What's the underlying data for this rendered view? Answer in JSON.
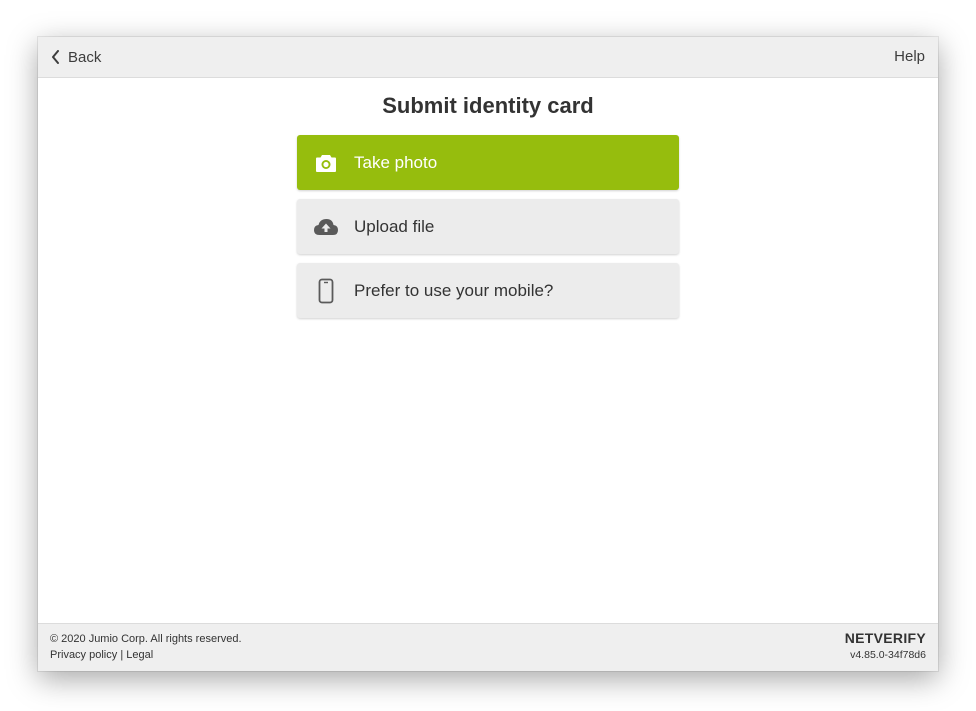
{
  "header": {
    "back_label": "Back",
    "help_label": "Help"
  },
  "main": {
    "title": "Submit identity card",
    "options": [
      {
        "label": "Take photo",
        "icon": "camera-icon"
      },
      {
        "label": "Upload file",
        "icon": "cloud-upload-icon"
      },
      {
        "label": "Prefer to use your mobile?",
        "icon": "mobile-phone-icon"
      }
    ]
  },
  "footer": {
    "copyright": "© 2020 Jumio Corp. All rights reserved.",
    "privacy_label": "Privacy policy",
    "separator": "|",
    "legal_label": "Legal",
    "brand": "NETVERIFY",
    "version": "v4.85.0-34f78d6"
  },
  "colors": {
    "accent": "#96bd0d",
    "secondary_button": "#ececec",
    "bar_background": "#efefef",
    "text": "#333333"
  }
}
